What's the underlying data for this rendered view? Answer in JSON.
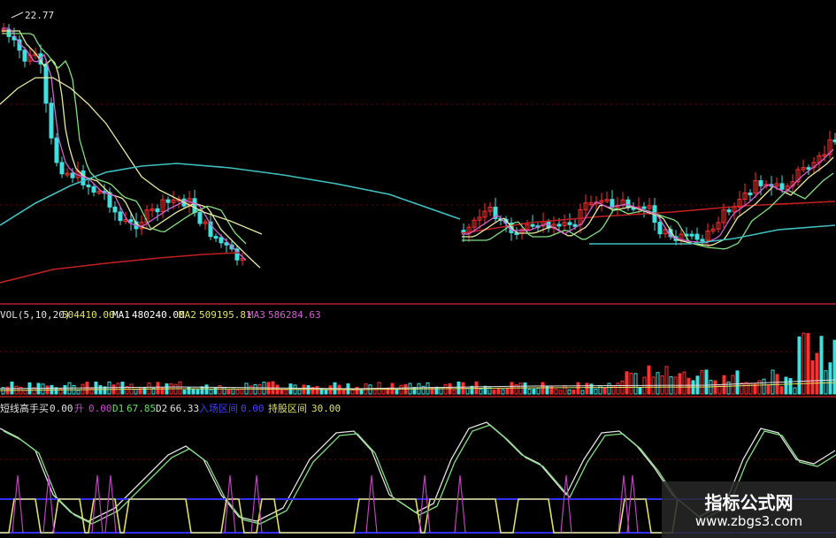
{
  "chart_data": [
    {
      "type": "candlestick",
      "panel": "price",
      "top_price_label": "22.77",
      "colors": {
        "up": "#ff3030",
        "down": "#40e0e0",
        "ma_yellow": "#e8e8a0",
        "ma_green": "#80e080",
        "ma_magenta": "#d060d0",
        "ma_long": "#40c0c0",
        "ma_red": "#c02020",
        "grid": "#800000"
      }
    },
    {
      "type": "bar",
      "panel": "volume",
      "indicator": "VOL(5,10,20)",
      "legend": [
        {
          "label": "",
          "value": "504410.00",
          "color": "#e0e060"
        },
        {
          "label": "MA1",
          "value": "480240.00",
          "color": "#ffffff"
        },
        {
          "label": "MA2",
          "value": "509195.81",
          "color": "#e0e060"
        },
        {
          "label": "MA3",
          "value": "586284.63",
          "color": "#d060d0"
        }
      ]
    },
    {
      "type": "line",
      "panel": "indicator",
      "legend": [
        {
          "label": "短线高手买",
          "value": "0.00",
          "color": "#e0e0e0"
        },
        {
          "label": "升",
          "value": "0.00",
          "color": "#d040d0"
        },
        {
          "label": "D1",
          "value": "67.85",
          "color": "#60e060"
        },
        {
          "label": "D2",
          "value": "66.33",
          "color": "#e0e0e0"
        },
        {
          "label": "入场区间",
          "value": "0.00",
          "color": "#4040ff"
        },
        {
          "label": "持股区间",
          "value": "30.00",
          "color": "#e0e060"
        }
      ]
    }
  ],
  "watermark": {
    "title": "指标公式网",
    "url": "www.zbgs3.com"
  }
}
